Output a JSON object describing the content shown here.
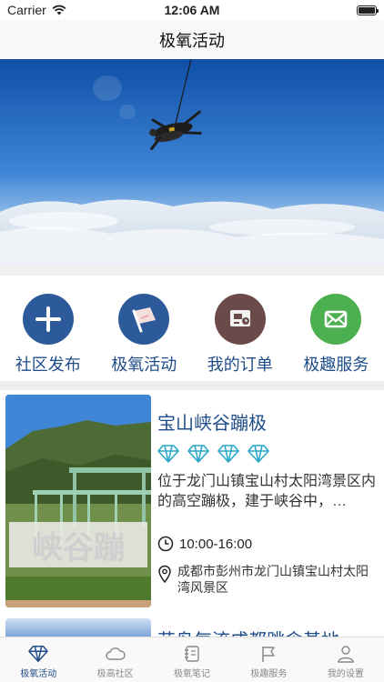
{
  "status": {
    "carrier": "Carrier",
    "time": "12:06 AM"
  },
  "nav": {
    "title": "极氧活动"
  },
  "quick_menu": [
    {
      "label": "社区发布",
      "icon": "plus-icon",
      "color": "#2d5a9a"
    },
    {
      "label": "极氧活动",
      "icon": "flag-icon",
      "color": "#2d5a9a"
    },
    {
      "label": "我的订单",
      "icon": "order-icon",
      "color": "#6b4a4a"
    },
    {
      "label": "极趣服务",
      "icon": "mail-icon",
      "color": "#4caf50"
    }
  ],
  "activity": {
    "title": "宝山峡谷蹦极",
    "rating": 4,
    "description": "位于龙门山镇宝山村太阳湾景区内的高空蹦极，建于峡谷中，…",
    "time": "10:00-16:00",
    "address": "成都市彭州市龙门山镇宝山村太阳湾风景区",
    "thumb_sign": "峡谷蹦"
  },
  "next_activity": {
    "title": "花鸟气流成都跳伞基地"
  },
  "tabs": [
    {
      "label": "极氧活动",
      "icon": "diamond-icon",
      "active": true
    },
    {
      "label": "极高社区",
      "icon": "cloud-icon",
      "active": false
    },
    {
      "label": "极氧笔记",
      "icon": "notebook-icon",
      "active": false
    },
    {
      "label": "极趣服务",
      "icon": "flag-outline-icon",
      "active": false
    },
    {
      "label": "我的设置",
      "icon": "person-icon",
      "active": false
    }
  ],
  "colors": {
    "accent": "#1f4d8a",
    "tab_inactive": "#888888"
  }
}
